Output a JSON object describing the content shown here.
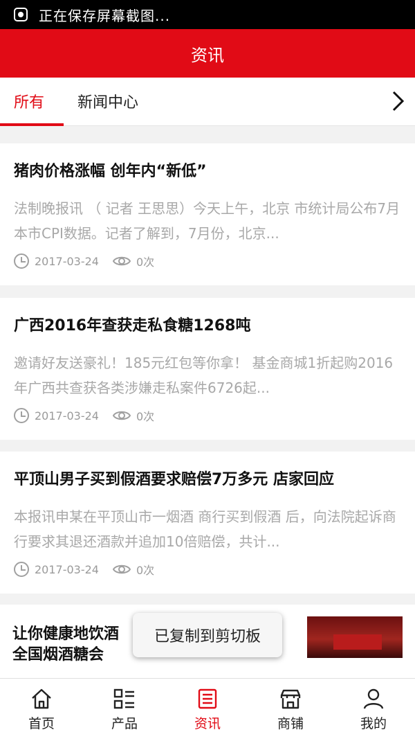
{
  "status_bar": {
    "text": "正在保存屏幕截图..."
  },
  "header": {
    "title": "资讯"
  },
  "tabs": [
    {
      "label": "所有",
      "active": true
    },
    {
      "label": "新闻中心",
      "active": false
    }
  ],
  "articles": [
    {
      "title": "猪肉价格涨幅 创年内“新低”",
      "summary": "法制晚报讯 （ 记者 王思思）今天上午，北京 市统计局公布7月本市CPI数据。记者了解到，7月份，北京...",
      "date": "2017-03-24",
      "views": "0次"
    },
    {
      "title": "广西2016年查获走私食糖1268吨",
      "summary": "邀请好友送豪礼！185元红包等你拿！ 基金商城1折起购2016年广西共查获各类涉嫌走私案件6726起...",
      "date": "2017-03-24",
      "views": "0次"
    },
    {
      "title": "平顶山男子买到假酒要求赔偿7万多元 店家回应",
      "summary": "本报讯申某在平顶山市一烟酒 商行买到假酒 后，向法院起诉商行要求其退还酒款并追加10倍赔偿，共计...",
      "date": "2017-03-24",
      "views": "0次"
    }
  ],
  "article4": {
    "title": "让你健康地饮酒 全国烟酒糖会"
  },
  "toast": {
    "text": "已复制到剪切板"
  },
  "bottom_nav": [
    {
      "label": "首页",
      "icon": "home-icon"
    },
    {
      "label": "产品",
      "icon": "product-list-icon"
    },
    {
      "label": "资讯",
      "icon": "news-icon",
      "active": true
    },
    {
      "label": "商铺",
      "icon": "shop-icon"
    },
    {
      "label": "我的",
      "icon": "user-icon"
    }
  ],
  "colors": {
    "brand": "#e10b16",
    "muted": "#a8a8a8"
  }
}
